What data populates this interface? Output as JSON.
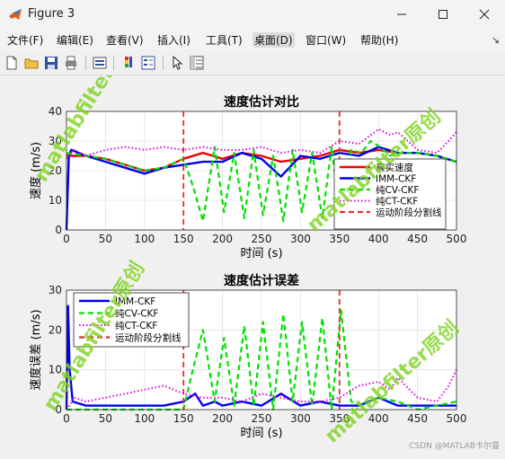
{
  "window": {
    "title": "Figure 3"
  },
  "menu": {
    "items": [
      {
        "label": "文件(F)"
      },
      {
        "label": "编辑(E)"
      },
      {
        "label": "查看(V)"
      },
      {
        "label": "插入(I)"
      },
      {
        "label": "工具(T)"
      },
      {
        "label": "桌面(D)"
      },
      {
        "label": "窗口(W)"
      },
      {
        "label": "帮助(H)"
      }
    ],
    "active_index": 5
  },
  "toolbar": {
    "icons": [
      "new-figure-icon",
      "open-file-icon",
      "save-icon",
      "print-icon",
      "link-plot-icon",
      "insert-colorbar-icon",
      "insert-legend-icon",
      "cursor-icon",
      "property-inspector-icon"
    ]
  },
  "watermark": {
    "text": "matlabfilter原创"
  },
  "footer": {
    "credit": "CSDN @MATLAB卡尔曼"
  },
  "colors": {
    "imm": "#0000ee",
    "cv": "#00e000",
    "ct": "#e000e0",
    "true": "#ee0000",
    "divider": "#e03030"
  },
  "chart_data": [
    {
      "type": "line",
      "title": "速度估计对比",
      "xlabel": "时间 (s)",
      "ylabel": "速度 (m/s)",
      "xlim": [
        0,
        500
      ],
      "ylim": [
        0,
        40
      ],
      "xticks": [
        "0",
        "50",
        "100",
        "150",
        "200",
        "250",
        "300",
        "350",
        "400",
        "450",
        "500"
      ],
      "yticks": [
        "0",
        "10",
        "20",
        "30",
        "40"
      ],
      "grid": true,
      "legend_position": "bottom-right",
      "dividers": [
        150,
        350
      ],
      "series": [
        {
          "name": "真实速度",
          "style": "solid",
          "color": "#ee0000",
          "x": [
            0,
            25,
            50,
            75,
            100,
            125,
            150,
            175,
            200,
            225,
            250,
            275,
            300,
            325,
            350,
            375,
            400,
            425,
            450,
            475,
            500
          ],
          "y": [
            25,
            25,
            24,
            22,
            20,
            21,
            24,
            26,
            24,
            26,
            25,
            23,
            24,
            25,
            27,
            26,
            27,
            26,
            26,
            25,
            23
          ]
        },
        {
          "name": "IMM-CKF",
          "style": "solid",
          "color": "#0000ee",
          "x": [
            0,
            3,
            6,
            25,
            50,
            75,
            100,
            125,
            150,
            175,
            200,
            225,
            250,
            275,
            300,
            325,
            350,
            375,
            400,
            425,
            450,
            475,
            500
          ],
          "y": [
            0,
            25,
            27,
            25,
            23,
            21,
            19,
            21,
            22,
            23,
            23,
            26,
            24,
            18,
            25,
            24,
            26,
            25,
            28,
            26,
            26,
            25,
            23
          ]
        },
        {
          "name": "纯CV-CKF",
          "style": "dashed",
          "color": "#00e000",
          "x": [
            0,
            25,
            50,
            75,
            100,
            125,
            150,
            162,
            175,
            190,
            202,
            215,
            228,
            240,
            252,
            265,
            278,
            290,
            302,
            315,
            328,
            340,
            352,
            365,
            378,
            390,
            402,
            415,
            428,
            450,
            475,
            500
          ],
          "y": [
            26,
            25,
            24,
            22,
            20,
            21,
            24,
            15,
            3,
            28,
            6,
            26,
            4,
            27,
            5,
            25,
            3,
            27,
            6,
            26,
            4,
            28,
            2,
            27,
            26,
            30,
            28,
            25,
            26,
            26,
            25,
            23
          ]
        },
        {
          "name": "纯CT-CKF",
          "style": "dotted",
          "color": "#e000e0",
          "x": [
            0,
            10,
            25,
            50,
            75,
            100,
            125,
            150,
            175,
            200,
            225,
            250,
            275,
            300,
            325,
            350,
            375,
            400,
            415,
            425,
            450,
            475,
            490,
            500
          ],
          "y": [
            24,
            27,
            25,
            27,
            28,
            27,
            28,
            27,
            28,
            27,
            27,
            28,
            26,
            27,
            26,
            30,
            29,
            34,
            32,
            33,
            27,
            26,
            30,
            33
          ]
        }
      ],
      "divider_legend": "运动阶段分割线"
    },
    {
      "type": "line",
      "title": "速度估计误差",
      "xlabel": "时间 (s)",
      "ylabel": "速度误差 (m/s)",
      "xlim": [
        0,
        500
      ],
      "ylim": [
        0,
        30
      ],
      "xticks": [
        "0",
        "50",
        "100",
        "150",
        "200",
        "250",
        "300",
        "350",
        "400",
        "450",
        "500"
      ],
      "yticks": [
        "0",
        "10",
        "20",
        "30"
      ],
      "grid": true,
      "legend_position": "top-left",
      "dividers": [
        150,
        350
      ],
      "series": [
        {
          "name": "IMM-CKF",
          "style": "solid",
          "color": "#0000ee",
          "x": [
            0,
            2,
            4,
            8,
            25,
            50,
            75,
            100,
            125,
            150,
            165,
            175,
            190,
            200,
            225,
            250,
            275,
            300,
            325,
            350,
            375,
            400,
            425,
            450,
            475,
            500
          ],
          "y": [
            0,
            26,
            10,
            2,
            1,
            1,
            1,
            1,
            1,
            2,
            4,
            1,
            2,
            1,
            2,
            1,
            4,
            1,
            2,
            1,
            1,
            3,
            1,
            1,
            1,
            1
          ]
        },
        {
          "name": "纯CV-CKF",
          "style": "dashed",
          "color": "#00e000",
          "x": [
            0,
            150,
            162,
            175,
            190,
            202,
            215,
            228,
            240,
            252,
            265,
            278,
            290,
            302,
            315,
            328,
            340,
            352,
            365,
            378,
            400,
            425,
            450,
            475,
            500
          ],
          "y": [
            0,
            0,
            10,
            20,
            2,
            18,
            1,
            21,
            1,
            22,
            0,
            24,
            2,
            22,
            1,
            23,
            0,
            25,
            2,
            1,
            3,
            2,
            0,
            1,
            2
          ]
        },
        {
          "name": "纯CT-CKF",
          "style": "dotted",
          "color": "#e000e0",
          "x": [
            0,
            10,
            25,
            50,
            75,
            100,
            125,
            150,
            175,
            200,
            225,
            250,
            275,
            300,
            325,
            350,
            375,
            400,
            415,
            425,
            450,
            475,
            490,
            500
          ],
          "y": [
            0,
            3,
            2,
            3,
            4,
            5,
            6,
            4,
            3,
            3,
            2,
            4,
            3,
            2,
            2,
            3,
            6,
            7,
            5,
            8,
            3,
            2,
            6,
            10
          ]
        }
      ],
      "divider_legend": "运动阶段分割线"
    }
  ]
}
